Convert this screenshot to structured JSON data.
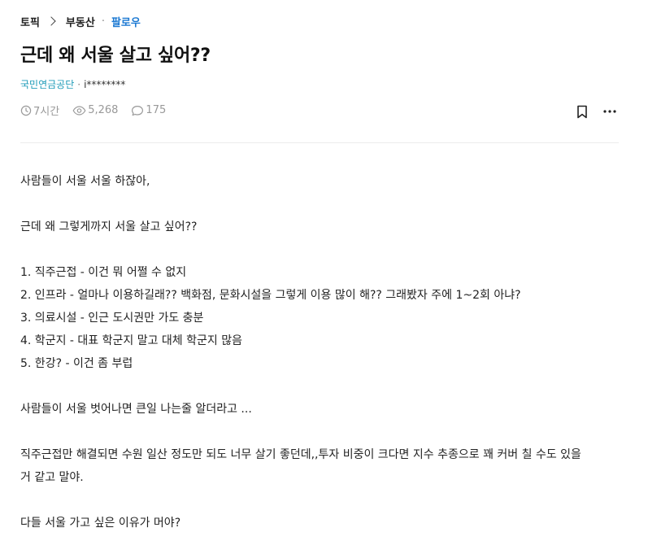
{
  "breadcrumb": {
    "topic": "토픽",
    "category": "부동산",
    "dot": "·",
    "follow": "팔로우"
  },
  "post": {
    "title": "근데 왜 서울 살고 싶어??",
    "author_company": "국민연금공단",
    "author_sep": "·",
    "author_nick": "i********",
    "time": "7시간",
    "views": "5,268",
    "comments": "175"
  },
  "icons": {
    "chevron": "chevron-right-icon",
    "clock": "clock-icon",
    "eye": "eye-icon",
    "comment": "comment-icon",
    "bookmark": "bookmark-icon",
    "more": "more-icon"
  },
  "colors": {
    "follow": "#1a78d2",
    "company": "#1e9bb8",
    "meta": "#999999"
  },
  "body": {
    "p1": "사람들이 서울 서울 하잖아,",
    "p2": "근데 왜 그렇게까지 서울 살고 싶어??",
    "list": [
      "1. 직주근접 - 이건 뭐 어쩔 수 없지",
      "2. 인프라 - 얼마나 이용하길래?? 백화점, 문화시설을 그렇게 이용 많이 해?? 그래봤자 주에 1~2회 아냐?",
      "3. 의료시설 - 인근 도시권만 가도 충분",
      "4. 학군지 - 대표 학군지 말고 대체 학군지 많음",
      "5. 한강? - 이건 좀 부럽"
    ],
    "p3": "사람들이 서울 벗어나면 큰일 나는줄 알더라고 ...",
    "p4_line1": "직주근접만 해결되면 수원 일산 정도만 되도 너무 살기 좋던데,,투자 비중이 크다면 지수 추종으로 꽤 커버 칠 수도 있을",
    "p4_line2": "거 같고 말야.",
    "p5": "다들 서울 가고 싶은 이유가 머야?"
  }
}
